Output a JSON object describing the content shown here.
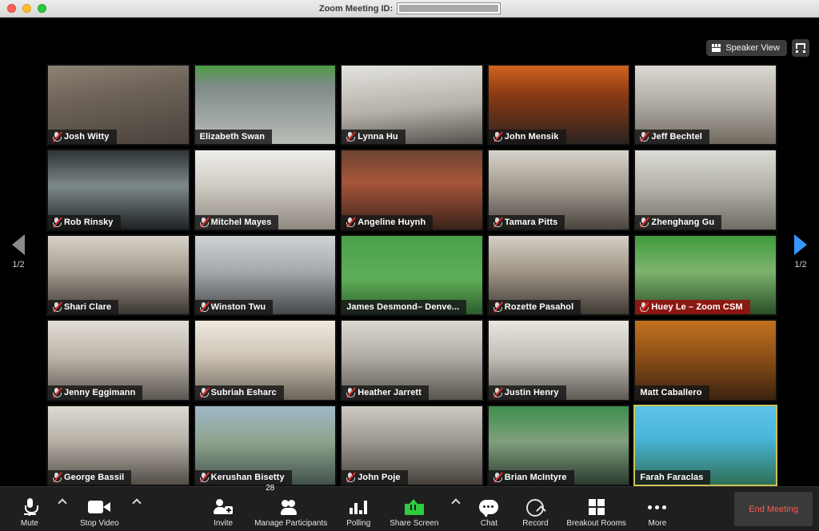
{
  "window": {
    "title_prefix": "Zoom Meeting ID:",
    "meeting_id_redacted": true
  },
  "view_controls": {
    "speaker_view_label": "Speaker View",
    "gallery_icon": "gallery-grid-icon",
    "fullscreen_icon": "enter-fullscreen-icon"
  },
  "pager": {
    "left_label": "1/2",
    "right_label": "1/2",
    "left_arrow_color": "#8a8a8a",
    "right_arrow_color": "#3399ff"
  },
  "gallery": {
    "columns": 5,
    "rows": 5,
    "active_speaker_border": "#c9c35a",
    "participants": [
      {
        "name": "Josh Witty",
        "muted": true,
        "speaking": false,
        "active": false,
        "bg": "linear-gradient(170deg,#8d8374 0%,#6d6359 38%,#4a433c 100%)"
      },
      {
        "name": "Elizabeth Swan",
        "muted": false,
        "speaking": false,
        "active": false,
        "bg": "linear-gradient(180deg,#4d9c46 0%,#7f8b88 26%,#b9bdb8 100%)"
      },
      {
        "name": "Lynna Hu",
        "muted": true,
        "speaking": false,
        "active": false,
        "bg": "linear-gradient(175deg,#e4e3df 0%,#b5b0a8 55%,#54504c 100%)"
      },
      {
        "name": "John Mensik",
        "muted": true,
        "speaking": false,
        "active": false,
        "bg": "linear-gradient(180deg,#d2641f 0%,#8e3b14 35%,#2b2320 100%)"
      },
      {
        "name": "Jeff Bechtel",
        "muted": true,
        "speaking": false,
        "active": false,
        "bg": "linear-gradient(180deg,#dcd9d2 0%,#aeaaa3 50%,#70695f 100%)"
      },
      {
        "name": "Rob Rinsky",
        "muted": true,
        "speaking": false,
        "active": false,
        "bg": "linear-gradient(180deg,#2e3336 0%,#7e8a8c 45%,#1d2123 100%)"
      },
      {
        "name": "Mitchel Mayes",
        "muted": true,
        "speaking": false,
        "active": false,
        "bg": "linear-gradient(180deg,#efeeea 0%,#cfcac2 45%,#8d8780 100%)"
      },
      {
        "name": "Angeline Huynh",
        "muted": true,
        "speaking": false,
        "active": false,
        "bg": "linear-gradient(180deg,#6b4331 0%,#a8563a 40%,#3a221a 100%)"
      },
      {
        "name": "Tamara Pitts",
        "muted": true,
        "speaking": false,
        "active": false,
        "bg": "linear-gradient(180deg,#d9d4cb 0%,#9c958c 50%,#4a443e 100%)"
      },
      {
        "name": "Zhenghang Gu",
        "muted": true,
        "speaking": false,
        "active": false,
        "bg": "linear-gradient(180deg,#dcdcd6 0%,#b0aea6 50%,#6f6c66 100%)"
      },
      {
        "name": "Shari Clare",
        "muted": true,
        "speaking": false,
        "active": false,
        "bg": "linear-gradient(180deg,#d8d3c9 0%,#a59c90 45%,#3b3631 100%)"
      },
      {
        "name": "Winston Twu",
        "muted": true,
        "speaking": false,
        "active": false,
        "bg": "linear-gradient(180deg,#cfd3d6 0%,#a6a9ab 45%,#45484a 100%)"
      },
      {
        "name": "James Desmond– Denve...",
        "muted": false,
        "speaking": false,
        "active": false,
        "bg": "linear-gradient(180deg,#49a049 0%,#5fae57 55%,#2d5c2c 100%)"
      },
      {
        "name": "Rozette Pasahol",
        "muted": true,
        "speaking": false,
        "active": false,
        "bg": "linear-gradient(180deg,#d6cfc6 0%,#a09688 45%,#3f3a34 100%)"
      },
      {
        "name": "Huey Le – Zoom CSM",
        "muted": true,
        "speaking": true,
        "active": false,
        "bg": "linear-gradient(180deg,#3f9b3b 0%,#7db46f 45%,#2a4f27 100%)"
      },
      {
        "name": "Jenny Eggimann",
        "muted": true,
        "speaking": false,
        "active": false,
        "bg": "linear-gradient(180deg,#e3ded6 0%,#bdb6ac 45%,#5b5650 100%)"
      },
      {
        "name": "Subriah Esharc",
        "muted": true,
        "speaking": false,
        "active": false,
        "bg": "linear-gradient(180deg,#efe9df 0%,#cdc4b6 45%,#6b6459 100%)"
      },
      {
        "name": "Heather Jarrett",
        "muted": true,
        "speaking": false,
        "active": false,
        "bg": "linear-gradient(180deg,#dcd8d2 0%,#b2ada6 45%,#58534d 100%)"
      },
      {
        "name": "Justin Henry",
        "muted": true,
        "speaking": false,
        "active": false,
        "bg": "linear-gradient(180deg,#e9e6e0 0%,#c4c0b8 45%,#5f5a54 100%)"
      },
      {
        "name": "Matt Caballero",
        "muted": false,
        "speaking": false,
        "active": false,
        "bg": "linear-gradient(180deg,#c2721e 0%,#8e4f16 45%,#3b2410 100%)"
      },
      {
        "name": "George Bassil",
        "muted": true,
        "speaking": false,
        "active": false,
        "bg": "linear-gradient(180deg,#dedad2 0%,#b6b0a7 45%,#514c46 100%)"
      },
      {
        "name": "Kerushan Bisetty",
        "muted": true,
        "speaking": false,
        "active": false,
        "bg": "linear-gradient(180deg,#9fb8c9 0%,#8fa48e 45%,#41514a 100%)"
      },
      {
        "name": "John Poje",
        "muted": true,
        "speaking": false,
        "active": false,
        "bg": "linear-gradient(180deg,#cfcac2 0%,#9c978f 45%,#46413c 100%)"
      },
      {
        "name": "Brian McIntyre",
        "muted": true,
        "speaking": false,
        "active": false,
        "bg": "linear-gradient(180deg,#3f8e4c 0%,#7fa07d 45%,#2b3a30 100%)"
      },
      {
        "name": "Farah Faraclas",
        "muted": false,
        "speaking": false,
        "active": true,
        "bg": "linear-gradient(180deg,#5fc3e6 0%,#49b6dc 40%,#2f6f55 100%)"
      }
    ]
  },
  "toolbar": {
    "mute_label": "Mute",
    "stop_video_label": "Stop Video",
    "invite_label": "Invite",
    "manage_participants_label": "Manage Participants",
    "participants_count": "28",
    "polling_label": "Polling",
    "share_screen_label": "Share Screen",
    "chat_label": "Chat",
    "record_label": "Record",
    "breakout_rooms_label": "Breakout Rooms",
    "more_label": "More",
    "end_meeting_label": "End Meeting",
    "end_meeting_color": "#ff5a52",
    "share_screen_color": "#2ecc40"
  }
}
